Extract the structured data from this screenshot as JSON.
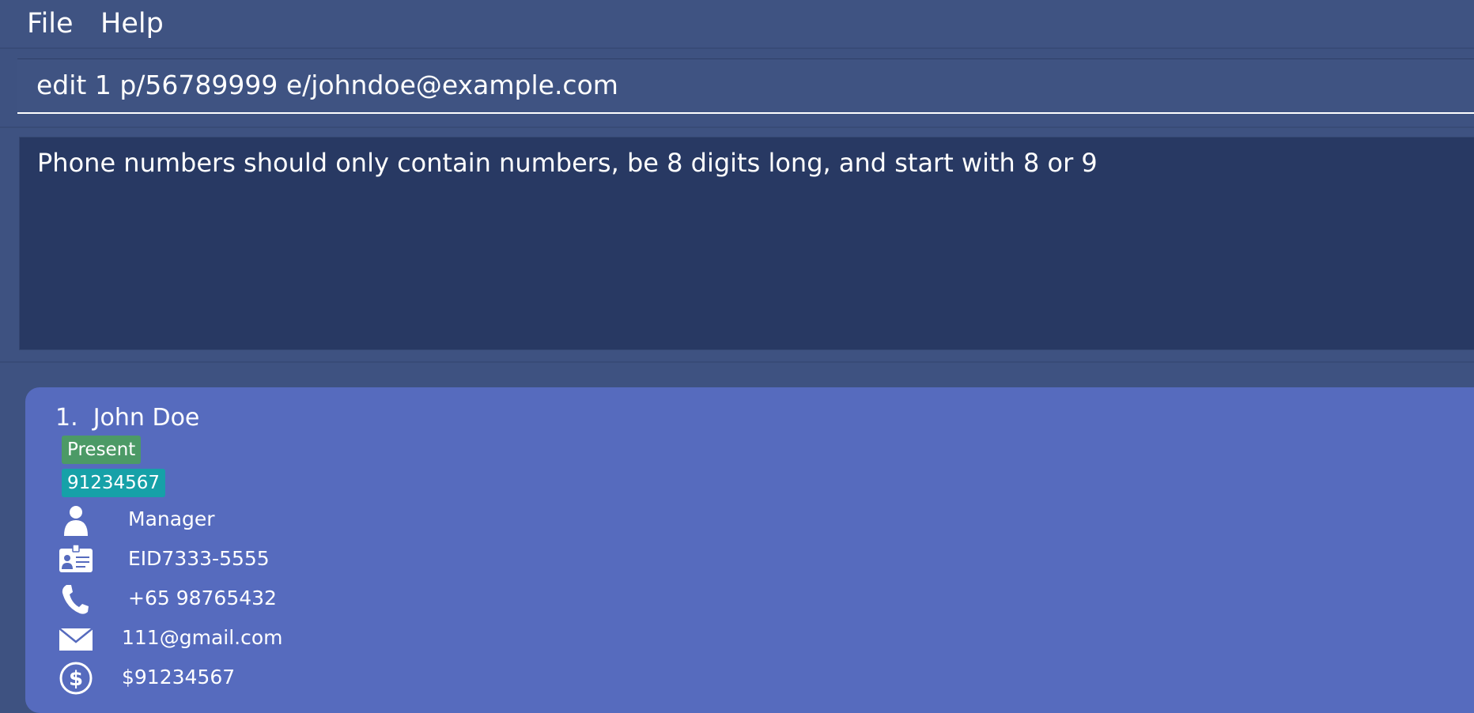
{
  "menu": {
    "file": "File",
    "help": "Help"
  },
  "command": {
    "value": "edit 1 p/56789999 e/johndoe@example.com"
  },
  "result": {
    "text": "Phone numbers should only contain numbers, be 8 digits long, and start with 8 or 9"
  },
  "persons": [
    {
      "index": "1.",
      "name": "John Doe",
      "status_tag": "Present",
      "phone_tag": "91234567",
      "role": "Manager",
      "employee_id": "EID7333-5555",
      "phone": "+65 98765432",
      "email": "111@gmail.com",
      "salary": "$91234567"
    }
  ],
  "icons": {
    "role": "person-icon",
    "employee_id": "id-card-icon",
    "phone": "phone-icon",
    "email": "envelope-icon",
    "salary": "dollar-icon"
  },
  "colors": {
    "background": "#3e5281",
    "result_background": "#283963",
    "card_background": "#566bbe",
    "status_tag": "#4c9a66",
    "phone_tag": "#16a1a8"
  }
}
